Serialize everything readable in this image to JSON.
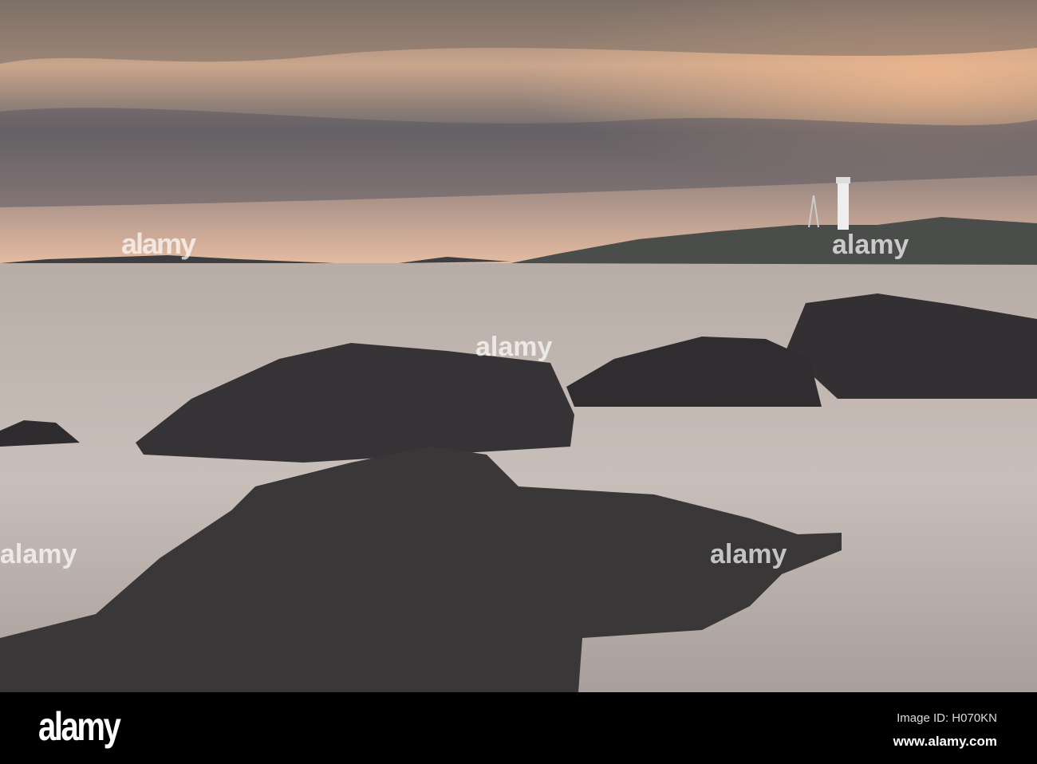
{
  "photo": {
    "subject": "lighthouse-seascape",
    "watermark_text": "alamy"
  },
  "footer": {
    "logo": "alamy",
    "image_id": "Image ID: H070KN",
    "website": "www.alamy.com"
  }
}
